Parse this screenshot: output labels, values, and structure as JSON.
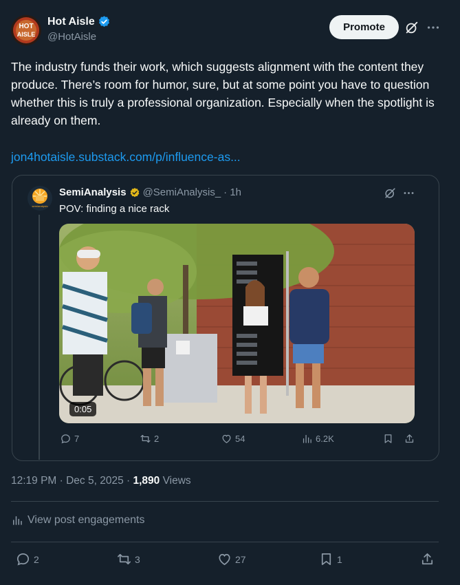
{
  "post": {
    "display_name": "Hot Aisle",
    "handle": "@HotAisle",
    "avatar_text_1": "HOT",
    "avatar_text_2": "AISLE",
    "promote_label": "Promote",
    "text": "The industry funds their work, which suggests alignment with the content they produce. There’s room for humor, sure, but at some point you have to question whether this is truly a professional organization. Especially when the spotlight is already on them.",
    "link": "jon4hotaisle.substack.com/p/influence-as...",
    "time": "12:19 PM · Dec 5, 2025 · ",
    "views_count": "1,890",
    "views_label": " Views",
    "engagements_label": "View post engagements",
    "actions": {
      "replies": "2",
      "reposts": "3",
      "likes": "27",
      "bookmarks": "1"
    }
  },
  "quote": {
    "display_name": "SemiAnalysis",
    "handle": "@SemiAnalysis_",
    "time": "· 1h",
    "avatar_text": "semianalysis",
    "text": "POV: finding a nice rack",
    "video_duration": "0:05",
    "actions": {
      "replies": "7",
      "reposts": "2",
      "likes": "54",
      "views": "6.2K"
    }
  },
  "colors": {
    "background": "#15202b",
    "link": "#1d9bf0",
    "muted": "#8b98a5",
    "verified_blue": "#1d9bf0",
    "verified_gold": "#e2b719"
  }
}
